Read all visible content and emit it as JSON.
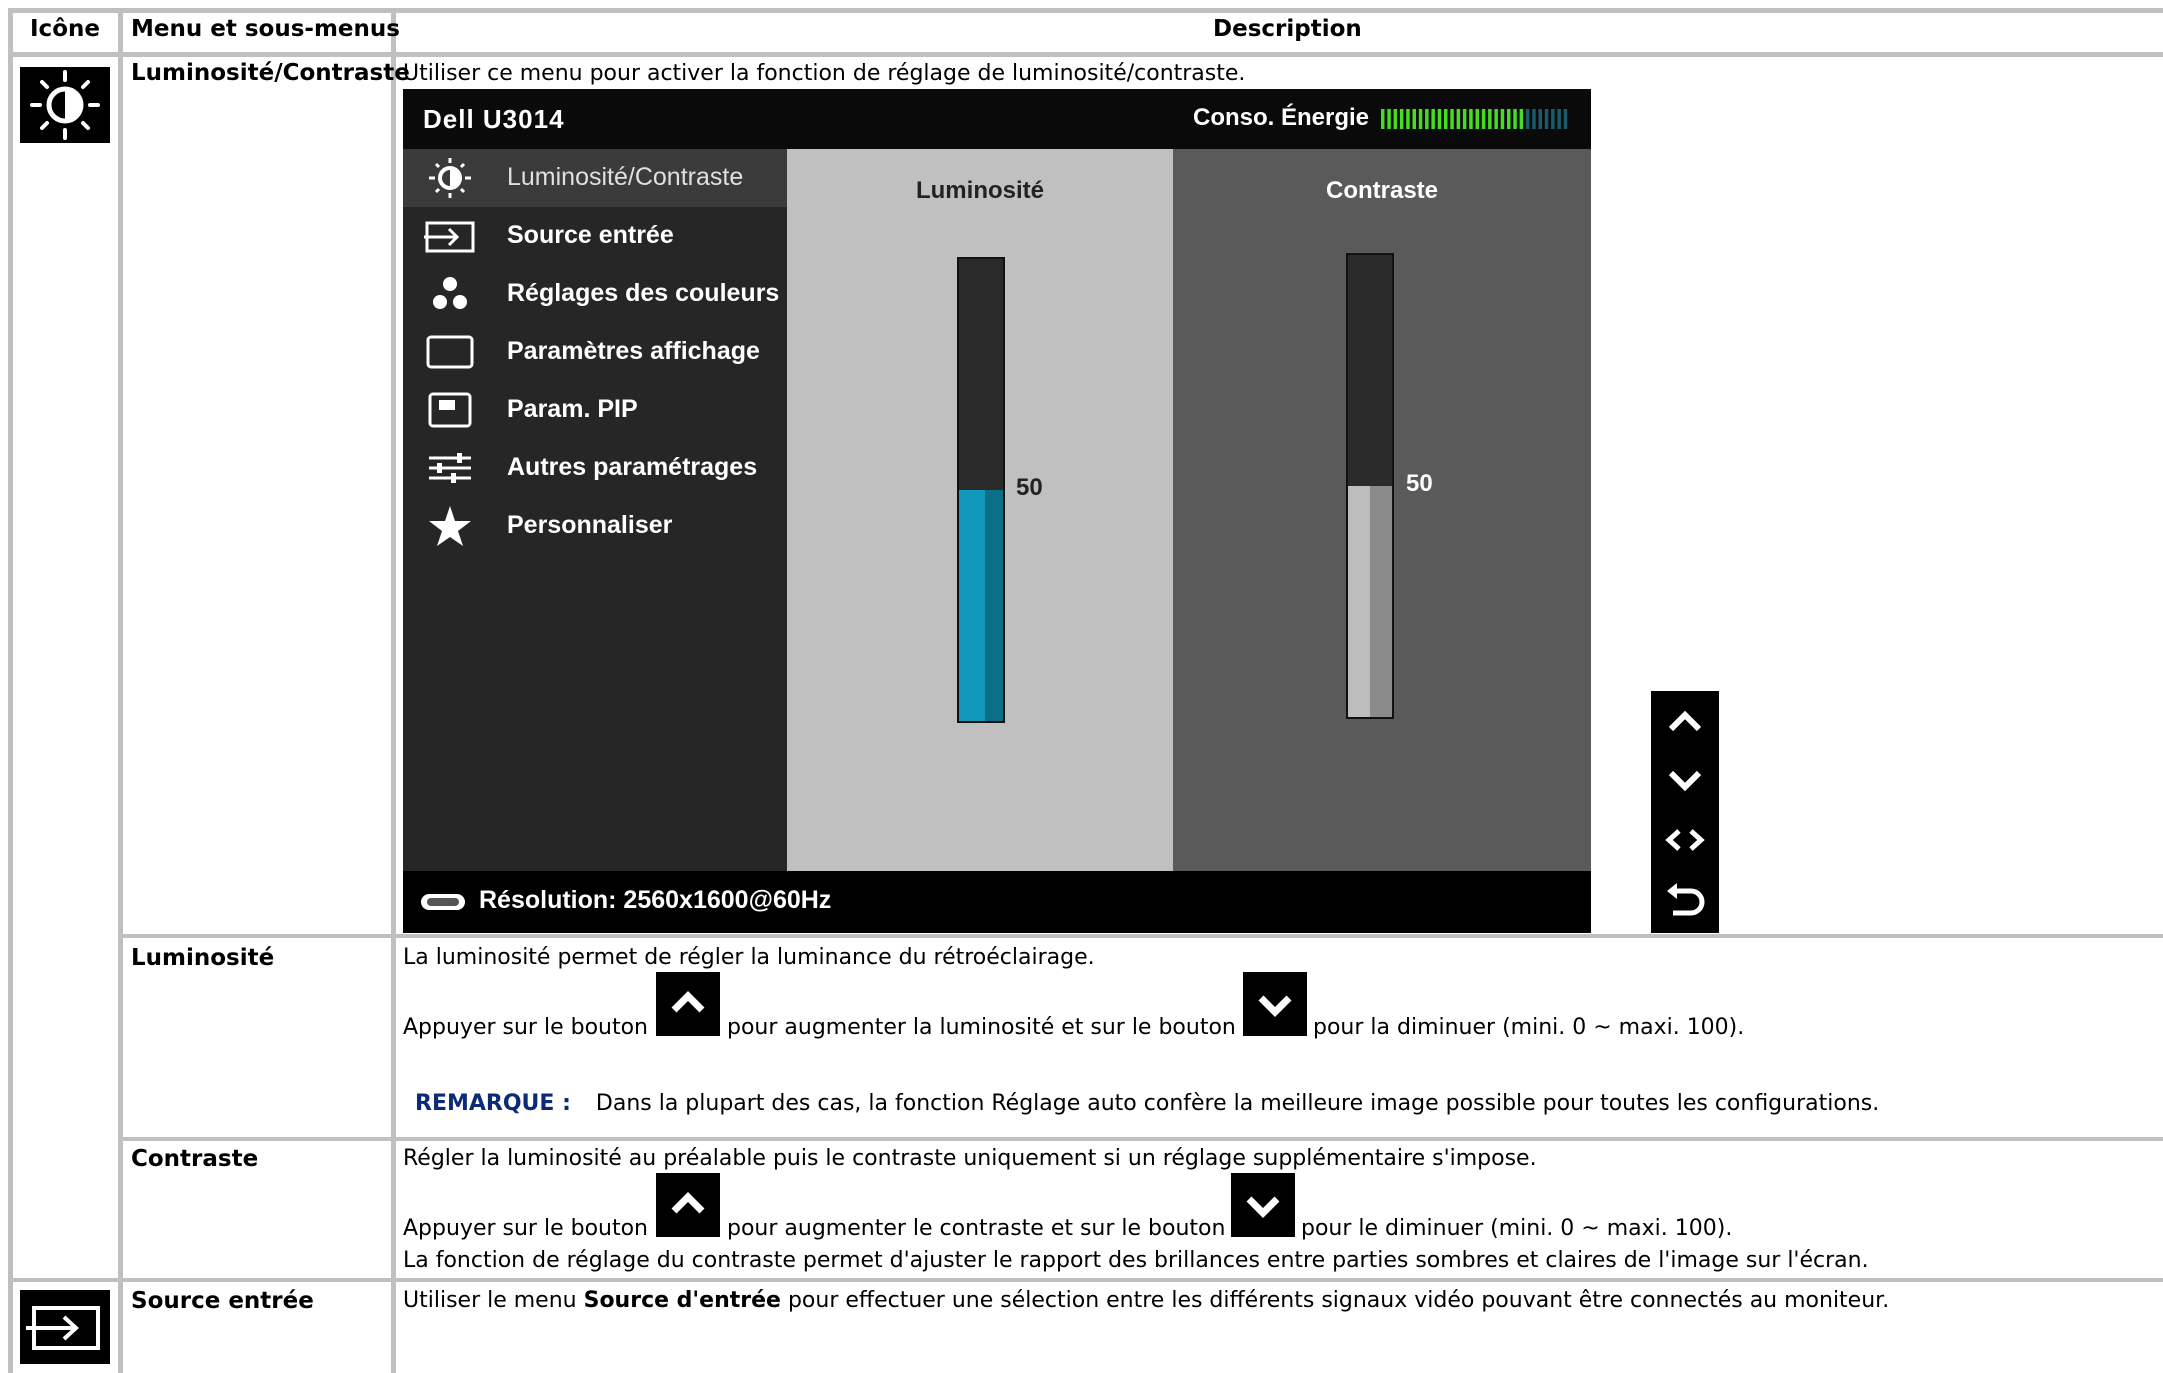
{
  "table": {
    "headers": {
      "icon": "Icône",
      "menu": "Menu et sous-menus",
      "description": "Description"
    }
  },
  "rows": {
    "brightness_contrast": {
      "title": "Luminosité/Contraste",
      "description": "Utiliser ce menu pour activer la fonction de réglage de luminosité/contraste."
    },
    "brightness": {
      "title": "Luminosité",
      "line1": "La luminosité permet de régler la luminance du rétroéclairage.",
      "press_prefix": "Appuyer sur le bouton",
      "press_middle": "pour augmenter la luminosité et sur le bouton",
      "press_suffix": "pour la diminuer (mini. 0 ~ maxi. 100).",
      "note_label": "REMARQUE :",
      "note_text": "Dans la plupart des cas, la fonction Réglage auto confère la meilleure image possible pour toutes les configurations."
    },
    "contrast": {
      "title": "Contraste",
      "line1": "Régler la luminosité au préalable puis le contraste uniquement si un réglage supplémentaire s'impose.",
      "press_prefix": "Appuyer sur le bouton",
      "press_middle": "pour augmenter le contraste et sur le bouton",
      "press_suffix": "pour le diminuer (mini. 0 ~ maxi. 100).",
      "line3": "La fonction de réglage du contraste permet d'ajuster le rapport des brillances entre parties sombres et claires de l'image sur l'écran."
    },
    "input_source": {
      "title": "Source entrée",
      "desc_prefix": "Utiliser le menu",
      "desc_bold": "Source d'entrée",
      "desc_suffix": "pour effectuer une sélection entre les différents signaux vidéo pouvant être connectés au moniteur."
    }
  },
  "osd": {
    "model": "Dell U3014",
    "energy_label": "Conso. Énergie",
    "energy_level": 0.75,
    "menu": [
      {
        "label": "Luminosité/Contraste",
        "icon": "brightness-icon",
        "active": true
      },
      {
        "label": "Source entrée",
        "icon": "input-source-icon"
      },
      {
        "label": "Réglages des couleurs",
        "icon": "color-dots-icon"
      },
      {
        "label": "Paramètres affichage",
        "icon": "display-rect-icon"
      },
      {
        "label": "Param. PIP",
        "icon": "pip-icon"
      },
      {
        "label": "Autres paramétrages",
        "icon": "sliders-icon"
      },
      {
        "label": "Personnaliser",
        "icon": "star-icon"
      }
    ],
    "brightness_label": "Luminosité",
    "brightness_value": "50",
    "contrast_label": "Contraste",
    "contrast_value": "50",
    "resolution": "Résolution: 2560x1600@60Hz",
    "colors": {
      "brightness_fill": "#1199bb",
      "contrast_fill": "#bdbdbd",
      "energy_on": "#44dd22",
      "energy_off": "#1c5a6a"
    }
  }
}
